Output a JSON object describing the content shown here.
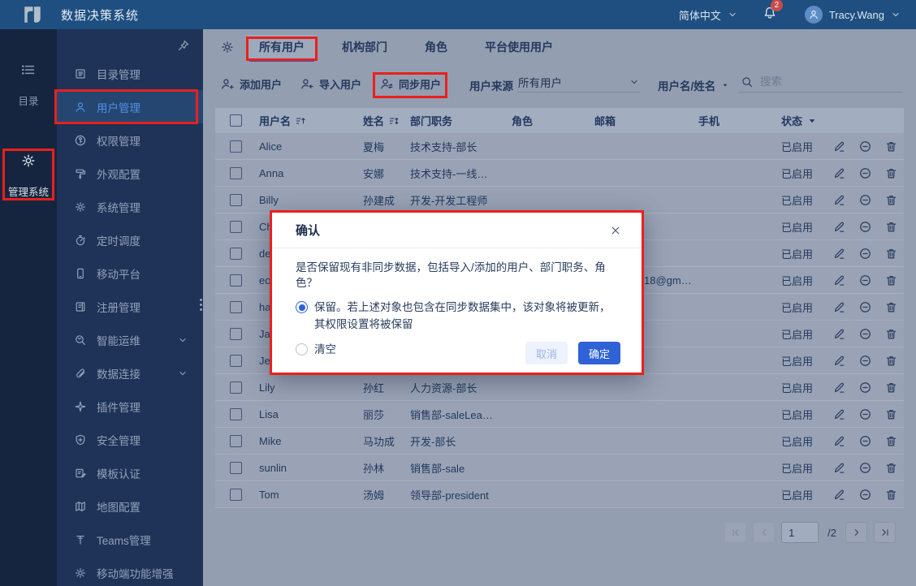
{
  "topbar": {
    "title": "数据决策系统",
    "language": "简体中文",
    "badge": "2",
    "user": "Tracy.Wang"
  },
  "rail": {
    "items": [
      {
        "label": "目录",
        "icon": "list",
        "active": false
      },
      {
        "label": "管理系统",
        "icon": "gear",
        "active": true
      }
    ]
  },
  "sidebar": {
    "items": [
      {
        "label": "目录管理",
        "icon": "book"
      },
      {
        "label": "用户管理",
        "icon": "user",
        "selected": true
      },
      {
        "label": "权限管理",
        "icon": "key"
      },
      {
        "label": "外观配置",
        "icon": "roller"
      },
      {
        "label": "系统管理",
        "icon": "gear"
      },
      {
        "label": "定时调度",
        "icon": "stopwatch"
      },
      {
        "label": "移动平台",
        "icon": "phone"
      },
      {
        "label": "注册管理",
        "icon": "doc"
      },
      {
        "label": "智能运维",
        "icon": "wrench",
        "expandable": true
      },
      {
        "label": "数据连接",
        "icon": "clip",
        "expandable": true
      },
      {
        "label": "插件管理",
        "icon": "sparkle"
      },
      {
        "label": "安全管理",
        "icon": "shield"
      },
      {
        "label": "模板认证",
        "icon": "docpen"
      },
      {
        "label": "地图配置",
        "icon": "map"
      },
      {
        "label": "Teams管理",
        "icon": "letterT"
      },
      {
        "label": "移动端功能增强",
        "icon": "gear"
      }
    ]
  },
  "tabs": {
    "items": [
      {
        "label": "所有用户",
        "active": true
      },
      {
        "label": "机构部门",
        "active": false
      },
      {
        "label": "角色",
        "active": false
      },
      {
        "label": "平台使用用户",
        "active": false
      }
    ]
  },
  "toolbar": {
    "buttons": [
      {
        "label": "添加用户",
        "icon": "userPlus"
      },
      {
        "label": "导入用户",
        "icon": "userImport"
      },
      {
        "label": "同步用户",
        "icon": "userSync"
      }
    ],
    "source_label": "用户来源",
    "source_value": "所有用户",
    "field_filter": "用户名/姓名",
    "search_placeholder": "搜索"
  },
  "table": {
    "headers": [
      {
        "label": "用户名",
        "icon": "sortAsc"
      },
      {
        "label": "姓名",
        "icon": "sortBoth"
      },
      {
        "label": "部门职务"
      },
      {
        "label": "角色"
      },
      {
        "label": "邮箱"
      },
      {
        "label": "手机"
      },
      {
        "label": "状态",
        "icon": "caretDown"
      }
    ],
    "rows": [
      {
        "username": "Alice",
        "name": "夏梅",
        "dept": "技术支持-部长",
        "role": "",
        "email": "",
        "phone": "",
        "status": "已启用"
      },
      {
        "username": "Anna",
        "name": "安娜",
        "dept": "技术支持-一线…",
        "status": "已启用"
      },
      {
        "username": "Billy",
        "name": "孙建成",
        "dept": "开发-开发工程师",
        "status": "已启用"
      },
      {
        "username": "Che",
        "status": "已启用"
      },
      {
        "username": "dem",
        "status": "已启用"
      },
      {
        "username": "eoc",
        "email": "18@gm…",
        "email_offset": true,
        "status": "已启用"
      },
      {
        "username": "han",
        "status": "已启用"
      },
      {
        "username": "Jack",
        "status": "已启用"
      },
      {
        "username": "Jen",
        "status": "已启用"
      },
      {
        "username": "Lily",
        "name": "孙红",
        "dept": "人力资源-部长",
        "status": "已启用"
      },
      {
        "username": "Lisa",
        "name": "丽莎",
        "dept": "销售部-saleLea…",
        "status": "已启用"
      },
      {
        "username": "Mike",
        "name": "马功成",
        "dept": "开发-部长",
        "status": "已启用"
      },
      {
        "username": "sunlin",
        "name": "孙林",
        "dept": "销售部-sale",
        "status": "已启用"
      },
      {
        "username": "Tom",
        "name": "汤姆",
        "dept": "领导部-president",
        "status": "已启用"
      }
    ]
  },
  "pagination": {
    "page": "1",
    "total": "/2"
  },
  "modal": {
    "title": "确认",
    "question": "是否保留现有非同步数据，包括导入/添加的用户、部门职务、角色？",
    "options": [
      {
        "label": "保留。若上述对象也包含在同步数据集中，该对象将被更新，其权限设置将被保留",
        "selected": true
      },
      {
        "label": "清空",
        "selected": false
      }
    ],
    "cancel_label": "取消",
    "confirm_label": "确定"
  },
  "colors": {
    "accent_blue": "#2e62d6",
    "annotation_red": "#e8211d",
    "topbar_blue": "#1e4f80"
  }
}
